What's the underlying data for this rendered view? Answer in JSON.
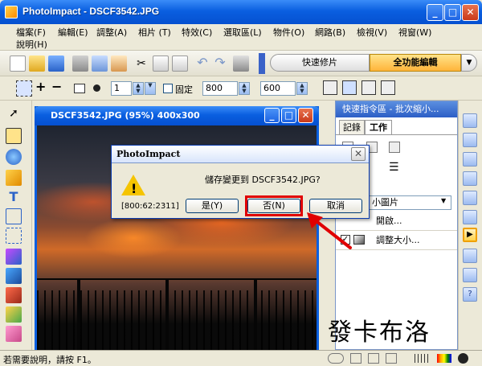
{
  "window": {
    "title": "PhotoImpact - DSCF3542.JPG",
    "minimize": "_",
    "maximize": "□",
    "close": "✕"
  },
  "menu": [
    "檔案(F)",
    "編輯(E)",
    "調整(A)",
    "相片 (T)",
    "特效(C)",
    "選取區(L)",
    "物件(O)",
    "網路(B)",
    "檢視(V)",
    "視窗(W)",
    "說明(H)"
  ],
  "toolbar": {
    "quick_fix": "快速修片",
    "full_edit": "全功能編輯",
    "dropdown_arrow": "▼"
  },
  "attributes": {
    "brush_size": "1",
    "fixed_label": "固定",
    "width": "800",
    "height": "600"
  },
  "document": {
    "title": "DSCF3542.JPG (95%) 400x300"
  },
  "panel": {
    "title": "快速指令區 - 批次縮小...",
    "tabs": [
      "記錄",
      "工作"
    ],
    "dropdown_value": "小圖片",
    "items": [
      "開啟...",
      "調整大小..."
    ]
  },
  "dialog": {
    "title": "PhotoImpact",
    "message": "儲存變更到 DSCF3542.JPG?",
    "code": "[800:62:2311]",
    "yes": "是(Y)",
    "no": "否(N)",
    "cancel": "取消",
    "close": "✕",
    "warning_mark": "!"
  },
  "status": {
    "help_text": "若需要說明，請按 F1。"
  },
  "watermark": "發卡布洛",
  "colors": {
    "titlebar": "#0a5fe0",
    "highlight": "#e00000",
    "accent_gold": "#ffb43a"
  }
}
